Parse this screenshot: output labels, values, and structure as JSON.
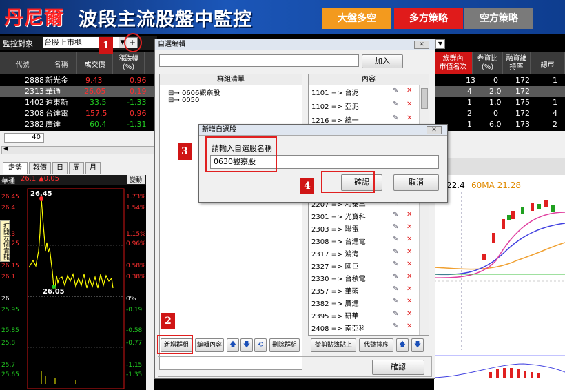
{
  "banner": {
    "brand": "丹尼爾",
    "title": "波段主流股盤中監控",
    "buttons": [
      "大盤多空",
      "多方策略",
      "空方策略"
    ]
  },
  "monitor": {
    "label": "監控對象",
    "value": "台股上市櫃",
    "plus": "+"
  },
  "table": {
    "headers": [
      "代號",
      "名稱",
      "成交價",
      "漲跌幅\n(%)"
    ],
    "rows": [
      {
        "code": "2888",
        "name": "新光金",
        "price": "9.43",
        "chg": "0.96"
      },
      {
        "code": "2313",
        "name": "華通",
        "price": "26.05",
        "chg": "0.19"
      },
      {
        "code": "1402",
        "name": "遠東新",
        "price": "33.5",
        "chg": "-1.33"
      },
      {
        "code": "2308",
        "name": "台達電",
        "price": "157.5",
        "chg": "0.96"
      },
      {
        "code": "2382",
        "name": "廣達",
        "price": "60.4",
        "chg": "-1.31"
      }
    ],
    "page_value": "40"
  },
  "right_table": {
    "headers": [
      "族群內\n市值名次",
      "券資比\n(%)",
      "融資維\n持率",
      "總市"
    ],
    "rows": [
      [
        "13",
        "0",
        "172",
        "1"
      ],
      [
        "4",
        "2.0",
        "172",
        ""
      ],
      [
        "1",
        "1.0",
        "175",
        "1"
      ],
      [
        "2",
        "0",
        "172",
        "4"
      ],
      [
        "1",
        "6.0",
        "173",
        "2"
      ]
    ]
  },
  "chart_tabs": [
    "走勢",
    "報價",
    "日",
    "周",
    "月"
  ],
  "quote": {
    "name": "華通",
    "price": "26.1",
    "change": "▲0.05",
    "mode": "變動"
  },
  "intraday": {
    "high_label": "26.45",
    "low_label": "26.05",
    "left_axis": [
      "26.45",
      "26.4",
      "26.3",
      "26.25",
      "26.15",
      "26.1",
      "26",
      "25.95",
      "25.85",
      "25.8",
      "25.7",
      "25.65"
    ],
    "right_axis": [
      "1.73%",
      "1.54%",
      "1.15%",
      "0.96%",
      "0.58%",
      "0.38%",
      "0%",
      "-0.19",
      "-0.58",
      "-0.77",
      "-1.15",
      "-1.35"
    ]
  },
  "side_vertical_text": "打開左側青龍",
  "kline": {
    "ma_labels": [
      "22.4",
      "60MA 21.28"
    ]
  },
  "dialog": {
    "title": "自選編輯",
    "add_button": "加入",
    "group_header": "群組清單",
    "content_header": "內容",
    "groups": [
      "0606觀察股",
      "0050"
    ],
    "content_top": [
      "1101 => 台泥",
      "1102 => 亞泥",
      "1216 => 統一"
    ],
    "content_bottom": [
      "2207 => 和泰車",
      "2301 => 光寶科",
      "2303 => 聯電",
      "2308 => 台達電",
      "2317 => 鴻海",
      "2327 => 國巨",
      "2330 => 台積電",
      "2357 => 華碩",
      "2382 => 廣達",
      "2395 => 研華",
      "2408 => 南亞科"
    ],
    "btn_new_group": "新增群組",
    "btn_edit": "編輯內容",
    "btn_delete_group": "刪除群組",
    "btn_paste": "從剪貼簿貼上",
    "btn_sort": "代號排序",
    "btn_ok": "確認"
  },
  "new_dialog": {
    "title": "新增自選股",
    "prompt": "請輸入自選股名稱",
    "value": "0630觀察股",
    "ok": "確認",
    "cancel": "取消"
  },
  "steps": [
    "1",
    "2",
    "3",
    "4"
  ],
  "colors": {
    "up": "#ff3030",
    "down": "#22cc22",
    "flat": "#ffff00",
    "highlight": "#e02020"
  }
}
